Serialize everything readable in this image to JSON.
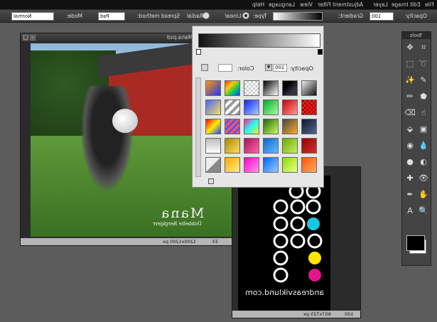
{
  "menubar": {
    "items": [
      "File",
      "Edit",
      "Image",
      "Layer",
      "Adjustment",
      "Filter",
      "View",
      "Language",
      "Help"
    ]
  },
  "options": {
    "opacity_label": "Opacity:",
    "opacity_value": "100",
    "gradient_label": "Gradient:",
    "type_label": "Type:",
    "linear_label": "Linear",
    "radial_label": "Radial",
    "spread_label": "Spread method:",
    "spread_value": "Pad",
    "mode_label": "Mode:",
    "mode_value": "Normal"
  },
  "doc1": {
    "title": "2011-07-19 - Mana.psd",
    "zoom": "33",
    "dimensions": "1200x1200 px",
    "watermark_big": "Mana",
    "watermark_small": "Dobbelte Bergkjerr"
  },
  "doc2": {
    "zoom": "100",
    "dimensions": "607x725 px",
    "site_text": "andreasviklund.com"
  },
  "gradient_panel": {
    "color_label": "Color:",
    "opacity_label": "Opacity:",
    "opacity_value": "100"
  },
  "toolbox": {
    "title": "Tools"
  },
  "colors": {
    "fg": "#000000",
    "bg": "#ffffff",
    "dot_cyan": "#17c8e0",
    "dot_yellow": "#ffe600",
    "dot_magenta": "#e4148c"
  }
}
